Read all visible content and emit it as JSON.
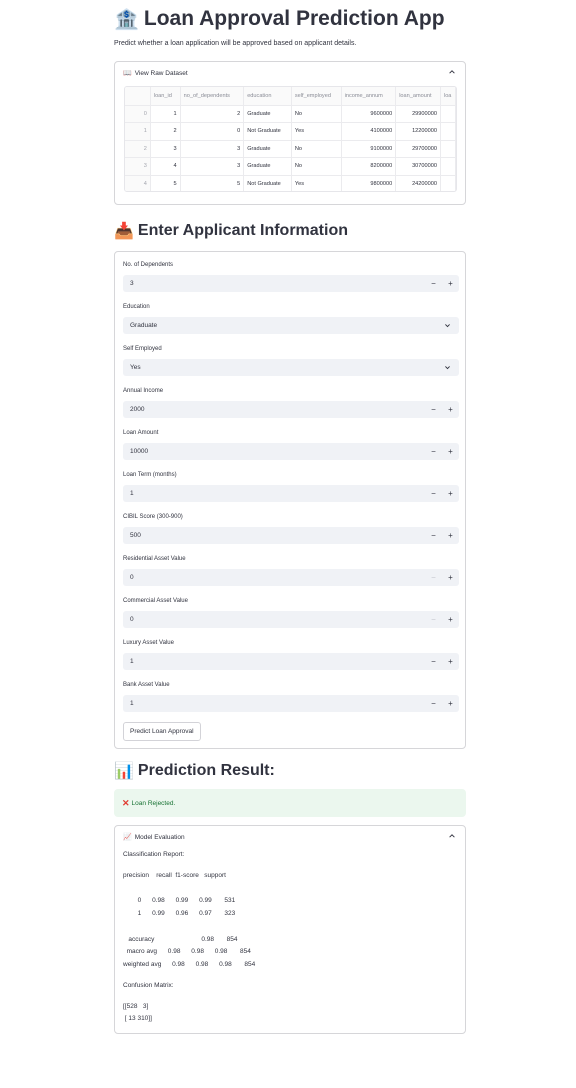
{
  "app": {
    "title": "Loan Approval Prediction App",
    "title_icon": "bank-emoji",
    "subtitle": "Predict whether a loan application will be approved based on applicant details."
  },
  "dataset": {
    "expander_label": "View Raw Dataset",
    "expander_icon": "open-book-emoji",
    "columns": [
      "",
      "loan_id",
      "no_of_dependents",
      "education",
      "self_employed",
      "income_annum",
      "loan_amount",
      "loa"
    ],
    "rows": [
      [
        "0",
        "1",
        "2",
        "Graduate",
        "No",
        "9600000",
        "29900000",
        ""
      ],
      [
        "1",
        "2",
        "0",
        "Not Graduate",
        "Yes",
        "4100000",
        "12200000",
        ""
      ],
      [
        "2",
        "3",
        "3",
        "Graduate",
        "No",
        "9100000",
        "29700000",
        ""
      ],
      [
        "3",
        "4",
        "3",
        "Graduate",
        "No",
        "8200000",
        "30700000",
        ""
      ],
      [
        "4",
        "5",
        "5",
        "Not Graduate",
        "Yes",
        "9800000",
        "24200000",
        ""
      ]
    ]
  },
  "form": {
    "heading": "Enter Applicant Information",
    "heading_icon": "inbox-tray-emoji",
    "fields": [
      {
        "label": "No. of Dependents",
        "value": "3",
        "type": "number",
        "minus_enabled": true
      },
      {
        "label": "Education",
        "value": "Graduate",
        "type": "select"
      },
      {
        "label": "Self Employed",
        "value": "Yes",
        "type": "select"
      },
      {
        "label": "Annual Income",
        "value": "2000",
        "type": "number",
        "minus_enabled": true
      },
      {
        "label": "Loan Amount",
        "value": "10000",
        "type": "number",
        "minus_enabled": true
      },
      {
        "label": "Loan Term (months)",
        "value": "1",
        "type": "number",
        "minus_enabled": true
      },
      {
        "label": "CIBIL Score (300-900)",
        "value": "500",
        "type": "number",
        "minus_enabled": true
      },
      {
        "label": "Residential Asset Value",
        "value": "0",
        "type": "number",
        "minus_enabled": false
      },
      {
        "label": "Commercial Asset Value",
        "value": "0",
        "type": "number",
        "minus_enabled": false
      },
      {
        "label": "Luxury Asset Value",
        "value": "1",
        "type": "number",
        "minus_enabled": true
      },
      {
        "label": "Bank Asset Value",
        "value": "1",
        "type": "number",
        "minus_enabled": true
      }
    ],
    "minus_glyph": "−",
    "plus_glyph": "+",
    "submit_label": "Predict Loan Approval"
  },
  "result": {
    "heading": "Prediction Result:",
    "heading_icon": "bar-chart-emoji",
    "alert_icon": "cross-mark-icon",
    "alert_text": "Loan Rejected.",
    "alert_color": "#177233"
  },
  "evaluation": {
    "expander_label": "Model Evaluation",
    "expander_icon": "chart-increasing-emoji",
    "report_title": "Classification Report:",
    "report_header": "precision    recall  f1-score   support",
    "report_rows": [
      "       0      0.98      0.99      0.99       531",
      "       1      0.99      0.96      0.97       323"
    ],
    "summary_rows": [
      "   accuracy                          0.98       854",
      "  macro avg      0.98      0.98      0.98       854",
      "weighted avg      0.98      0.98      0.98       854"
    ],
    "matrix_title": "Confusion Matrix:",
    "matrix_rows": [
      "[[528   3]",
      " [ 13 310]]"
    ]
  }
}
